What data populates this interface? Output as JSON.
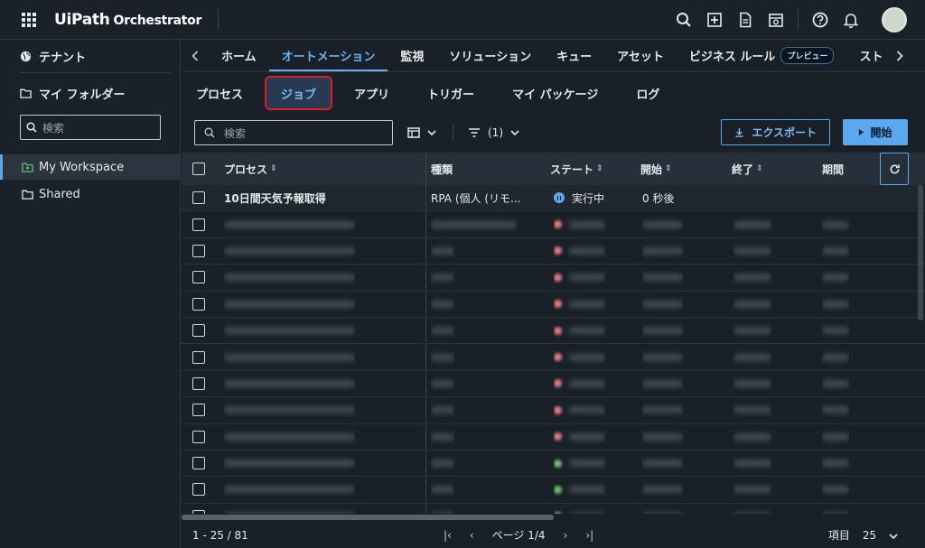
{
  "header": {
    "logo_main": "UiPath",
    "logo_sub": "Orchestrator"
  },
  "sidebar": {
    "tenant_label": "テナント",
    "my_folders_label": "マイ フォルダー",
    "search_placeholder": "検索",
    "items": [
      {
        "label": "My Workspace",
        "active": true
      },
      {
        "label": "Shared",
        "active": false
      }
    ]
  },
  "nav": {
    "tabs": [
      {
        "label": "ホーム"
      },
      {
        "label": "オートメーション"
      },
      {
        "label": "監視"
      },
      {
        "label": "ソリューション"
      },
      {
        "label": "キュー"
      },
      {
        "label": "アセット"
      },
      {
        "label": "ビジネス ルール"
      },
      {
        "label": "スト"
      }
    ],
    "preview_badge": "プレビュー"
  },
  "subtabs": [
    {
      "label": "プロセス"
    },
    {
      "label": "ジョブ"
    },
    {
      "label": "アプリ"
    },
    {
      "label": "トリガー"
    },
    {
      "label": "マイ パッケージ"
    },
    {
      "label": "ログ"
    }
  ],
  "toolbar": {
    "search_placeholder": "検索",
    "filter_count": "(1)",
    "export_label": "エクスポート",
    "start_label": "開始"
  },
  "table": {
    "columns": [
      {
        "label": "プロセス"
      },
      {
        "label": "種類"
      },
      {
        "label": "ステート"
      },
      {
        "label": "開始"
      },
      {
        "label": "終了"
      },
      {
        "label": "期間"
      }
    ],
    "first_row": {
      "process": "10日間天気予報取得",
      "type": "RPA (個人 (リモ...",
      "state": "実行中",
      "start": "0 秒後"
    }
  },
  "footer": {
    "range": "1 - 25 / 81",
    "page": "ページ 1/4",
    "items_label": "項目",
    "per_page": "25"
  }
}
